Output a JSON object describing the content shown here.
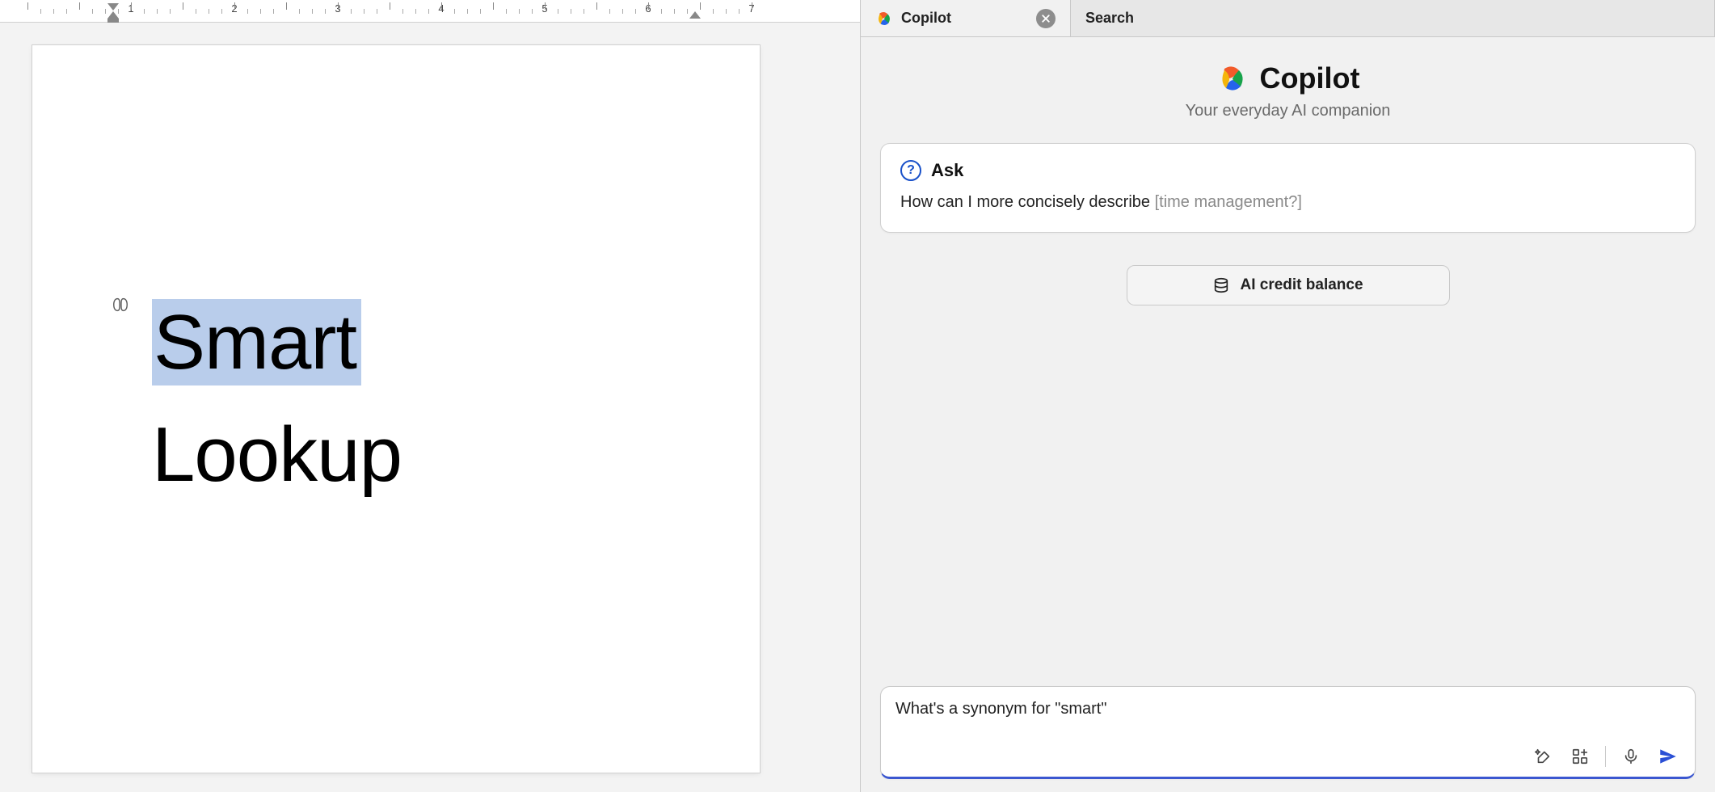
{
  "ruler": {
    "numbers": [
      "1",
      "2",
      "3",
      "4",
      "5",
      "6",
      "7"
    ]
  },
  "document": {
    "selected_word": "Smart",
    "second_line": "Lookup"
  },
  "side_tabs": {
    "copilot": "Copilot",
    "search": "Search"
  },
  "panel": {
    "title": "Copilot",
    "subtitle": "Your everyday AI companion"
  },
  "suggestion": {
    "label": "Ask",
    "text": "How can I more concisely describe ",
    "hint": "[time management?]"
  },
  "balance_button": "AI credit balance",
  "prompt": {
    "value": "What's a synonym for \"smart\""
  }
}
